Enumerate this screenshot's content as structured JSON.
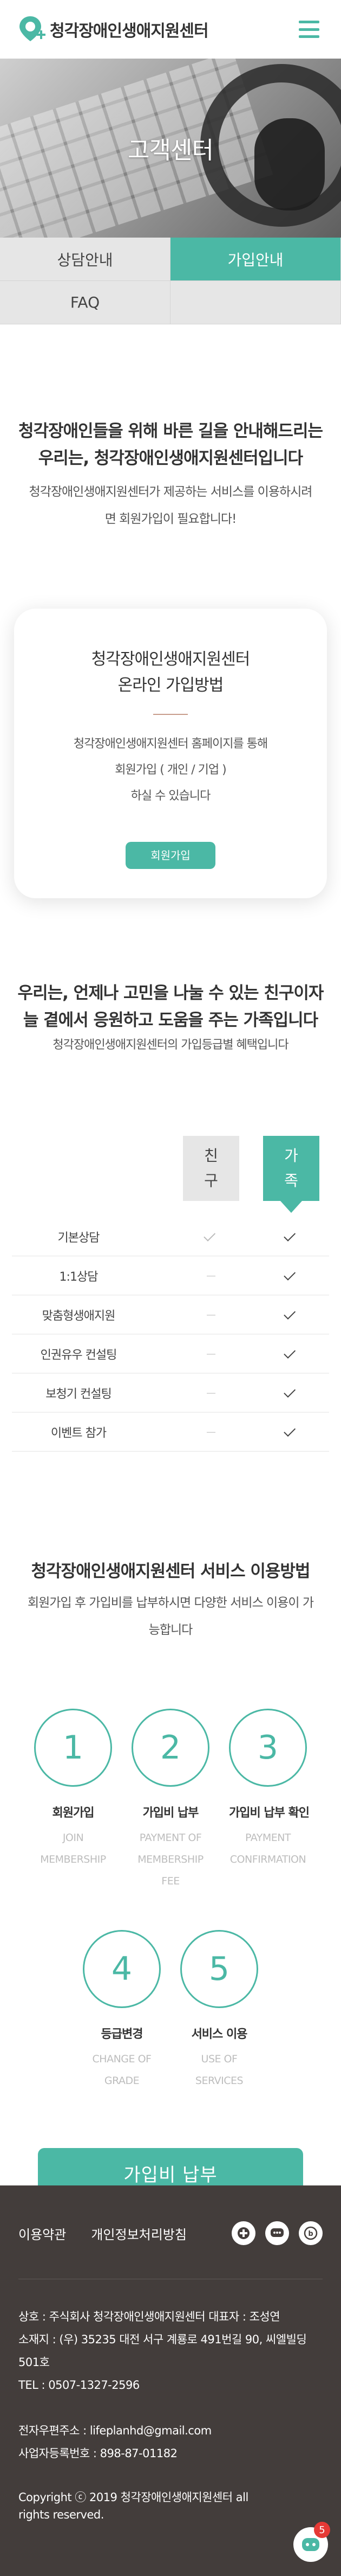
{
  "header": {
    "logo_text": "청각장애인생애지원센터",
    "menu_icon": "hamburger-menu-icon",
    "logo_icon": "location-pin-plus-icon",
    "accent_color": "#4bb8a5"
  },
  "hero": {
    "title": "고객센터"
  },
  "tabs": [
    {
      "label": "상담안내",
      "active": false
    },
    {
      "label": "가입안내",
      "active": true
    },
    {
      "label": "FAQ",
      "active": false
    }
  ],
  "intro": {
    "line1": "청각장애인들을 위해 바른 길을 안내해드리는",
    "line2": "우리는, 청각장애인생애지원센터입니다",
    "desc1": "청각장애인생애지원센터가 제공하는 서비스를 이용하시려",
    "desc2": "면 회원가입이 필요합니다!"
  },
  "card": {
    "title1": "청각장애인생애지원센터",
    "title2": "온라인 가입방법",
    "text1": "청각장애인생애지원센터 홈페이지를 통해",
    "text2": "회원가입 ( 개인 / 기업 )",
    "text3": "하실 수 있습니다",
    "button": "회원가입"
  },
  "family": {
    "title1": "우리는, 언제나 고민을 나눌 수 있는 친구이자",
    "title2": "늘 곁에서 응원하고 도움을 주는 가족입니다",
    "desc": "청각장애인생애지원센터의 가입등급별 혜택입니다"
  },
  "benefits": {
    "col_friend": "친구",
    "col_family": "가족",
    "rows": [
      {
        "label": "기본상담",
        "friend": "check",
        "family": "check"
      },
      {
        "label": "1:1상담",
        "friend": "dash",
        "family": "check"
      },
      {
        "label": "맞춤형생애지원",
        "friend": "dash",
        "family": "check"
      },
      {
        "label": "인권유우 컨설팅",
        "friend": "dash",
        "family": "check"
      },
      {
        "label": "보청기 컨설팅",
        "friend": "dash",
        "family": "check"
      },
      {
        "label": "이벤트 참가",
        "friend": "dash",
        "family": "check"
      }
    ]
  },
  "service": {
    "title": "청각장애인생애지원센터 서비스 이용방법",
    "desc1": "회원가입 후 가입비를 납부하시면 다양한 서비스 이용이 가",
    "desc2": "능합니다",
    "steps": [
      {
        "num": "1",
        "kr": "회원가입",
        "en1": "JOIN",
        "en2": "MEMBERSHIP",
        "en3": ""
      },
      {
        "num": "2",
        "kr": "가입비 납부",
        "en1": "PAYMENT OF",
        "en2": "MEMBERSHIP",
        "en3": "FEE"
      },
      {
        "num": "3",
        "kr": "가입비 납부 확인",
        "en1": "PAYMENT",
        "en2": "CONFIRMATION",
        "en3": ""
      },
      {
        "num": "4",
        "kr": "등급변경",
        "en1": "CHANGE OF",
        "en2": "GRADE",
        "en3": ""
      },
      {
        "num": "5",
        "kr": "서비스 이용",
        "en1": "USE OF",
        "en2": "SERVICES",
        "en3": ""
      }
    ],
    "pay_button": "가입비 납부"
  },
  "footer": {
    "terms": "이용약관",
    "privacy": "개인정보처리방침",
    "icons": [
      "kakao-plus-icon",
      "chat-icon",
      "blog-icon"
    ],
    "company": "상호 : 주식회사 청각장애인생애지원센터   대표자 : 조성연",
    "address": "소재지 : (우) 35235 대전 서구 계룡로 491번길 90, 씨엘빌딩 501호",
    "tel": "TEL : 0507-1327-2596",
    "email": "전자우편주소 : lifeplanhd@gmail.com",
    "bizno": "사업자등록번호 : 898-87-01182",
    "copyright": "Copyright ⓒ 2019 청각장애인생애지원센터 all rights reserved.",
    "chat_badge": "5"
  }
}
